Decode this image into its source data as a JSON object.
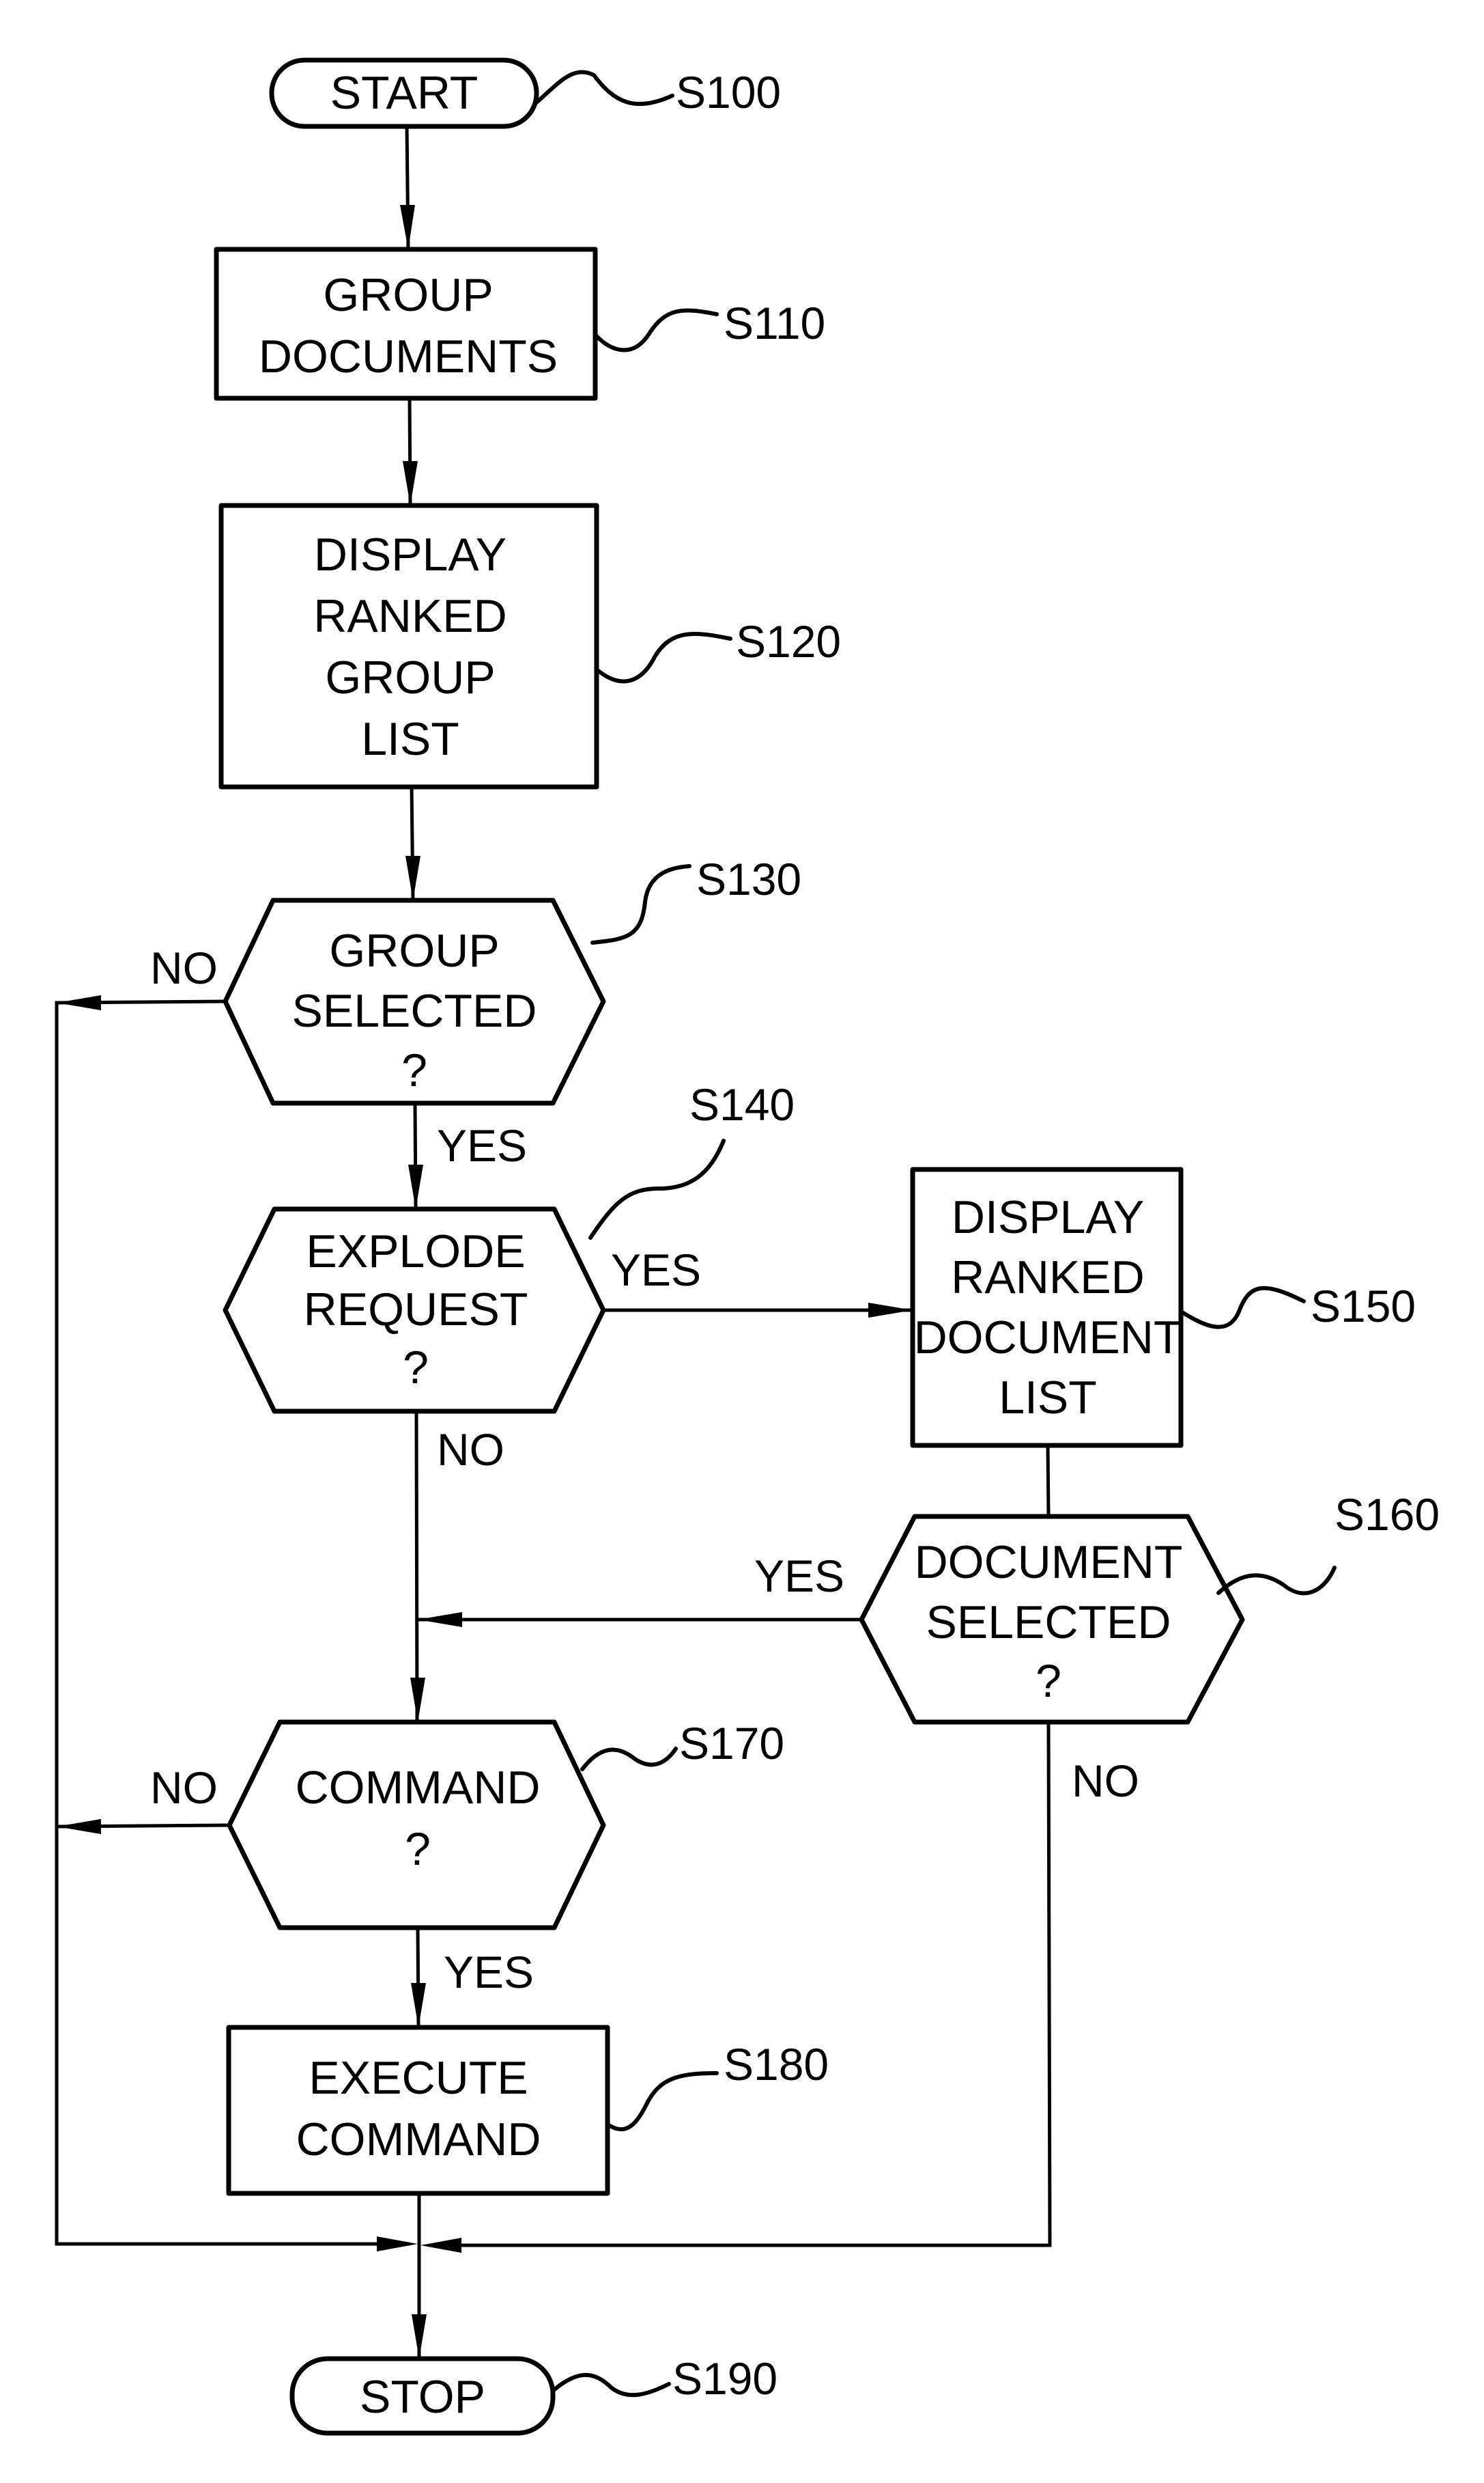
{
  "diagram": {
    "type": "flowchart",
    "nodes": [
      {
        "id": "S100",
        "kind": "terminal",
        "lines": [
          "START"
        ],
        "ref": "S100"
      },
      {
        "id": "S110",
        "kind": "process",
        "lines": [
          "GROUP",
          "DOCUMENTS"
        ],
        "ref": "S110"
      },
      {
        "id": "S120",
        "kind": "process",
        "lines": [
          "DISPLAY",
          "RANKED",
          "GROUP",
          "LIST"
        ],
        "ref": "S120"
      },
      {
        "id": "S130",
        "kind": "decision",
        "lines": [
          "GROUP",
          "SELECTED",
          "?"
        ],
        "ref": "S130"
      },
      {
        "id": "S140",
        "kind": "decision",
        "lines": [
          "EXPLODE",
          "REQUEST",
          "?"
        ],
        "ref": "S140"
      },
      {
        "id": "S150",
        "kind": "process",
        "lines": [
          "DISPLAY",
          "RANKED",
          "DOCUMENT",
          "LIST"
        ],
        "ref": "S150"
      },
      {
        "id": "S160",
        "kind": "decision",
        "lines": [
          "DOCUMENT",
          "SELECTED",
          "?"
        ],
        "ref": "S160"
      },
      {
        "id": "S170",
        "kind": "decision",
        "lines": [
          "COMMAND",
          "?"
        ],
        "ref": "S170"
      },
      {
        "id": "S180",
        "kind": "process",
        "lines": [
          "EXECUTE",
          "COMMAND"
        ],
        "ref": "S180"
      },
      {
        "id": "S190",
        "kind": "terminal",
        "lines": [
          "STOP"
        ],
        "ref": "S190"
      }
    ],
    "edges": [
      {
        "from": "S100",
        "to": "S110",
        "label": ""
      },
      {
        "from": "S110",
        "to": "S120",
        "label": ""
      },
      {
        "from": "S120",
        "to": "S130",
        "label": ""
      },
      {
        "from": "S130",
        "to": "S190",
        "label": "NO"
      },
      {
        "from": "S130",
        "to": "S140",
        "label": "YES"
      },
      {
        "from": "S140",
        "to": "S150",
        "label": "YES"
      },
      {
        "from": "S140",
        "to": "S170",
        "label": "NO"
      },
      {
        "from": "S150",
        "to": "S160",
        "label": ""
      },
      {
        "from": "S160",
        "to": "S170",
        "label": "YES"
      },
      {
        "from": "S160",
        "to": "S190",
        "label": "NO"
      },
      {
        "from": "S170",
        "to": "S190",
        "label": "NO"
      },
      {
        "from": "S170",
        "to": "S180",
        "label": "YES"
      },
      {
        "from": "S180",
        "to": "S190",
        "label": ""
      }
    ],
    "edge_labels": {
      "s130_no": "NO",
      "s130_yes": "YES",
      "s140_yes": "YES",
      "s140_no": "NO",
      "s160_yes": "YES",
      "s160_no": "NO",
      "s170_no": "NO",
      "s170_yes": "YES"
    }
  }
}
